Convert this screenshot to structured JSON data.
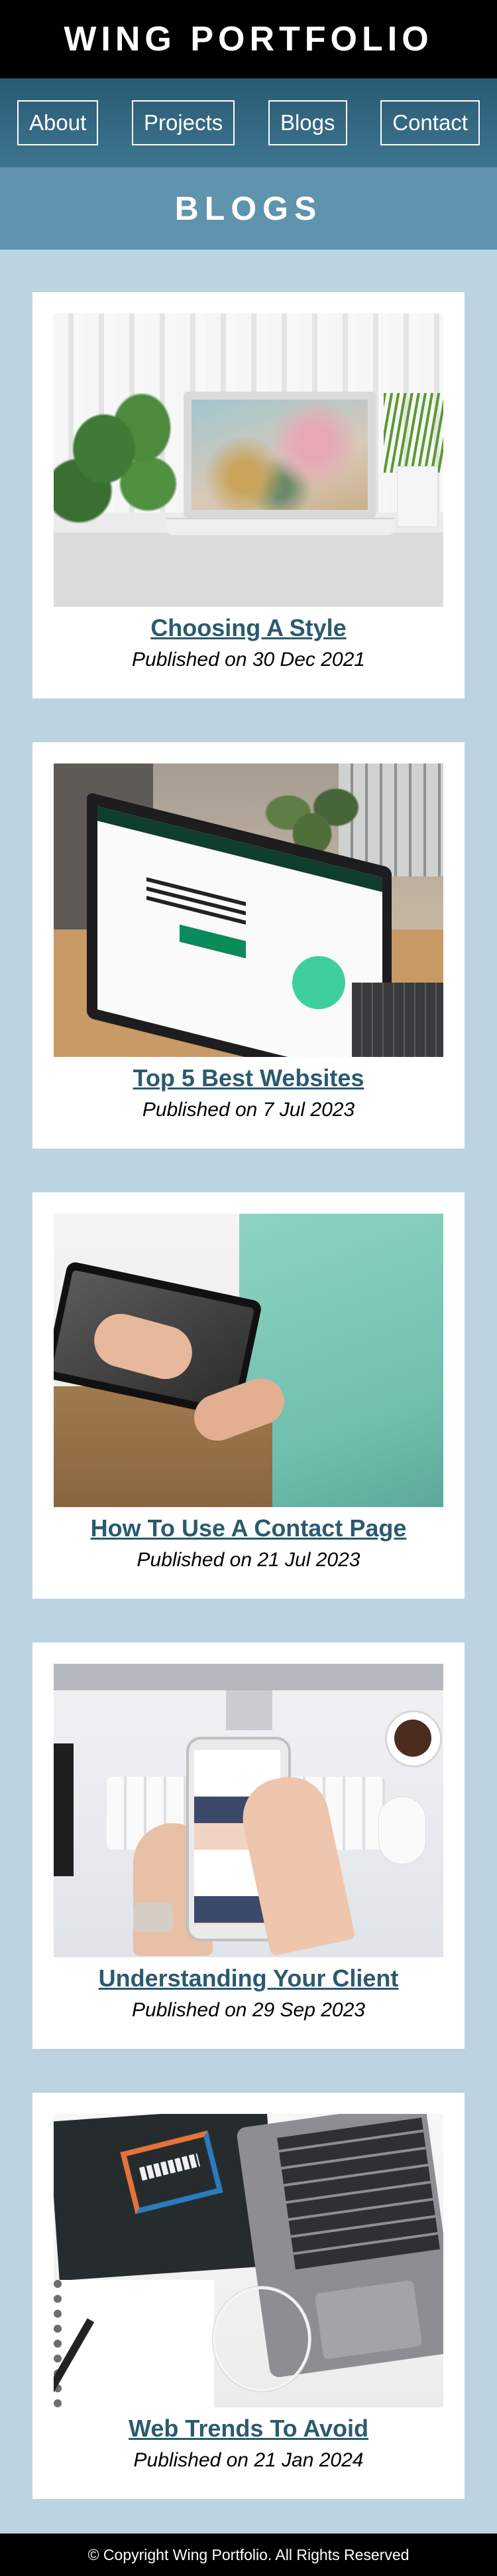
{
  "header": {
    "site_title": "WING PORTFOLIO"
  },
  "nav": {
    "items": [
      {
        "label": "About"
      },
      {
        "label": "Projects"
      },
      {
        "label": "Blogs"
      },
      {
        "label": "Contact"
      }
    ]
  },
  "section": {
    "title": "BLOGS"
  },
  "blogs": [
    {
      "title": "Choosing A Style",
      "date": "Published on 30 Dec 2021",
      "image_icon": "laptop-on-desk-image"
    },
    {
      "title": "Top 5 Best Websites",
      "date": "Published on 7 Jul 2023",
      "image_icon": "shopify-laptop-image"
    },
    {
      "title": "How To Use A Contact Page",
      "date": "Published on 21 Jul 2023",
      "image_icon": "tablet-in-hands-image"
    },
    {
      "title": "Understanding Your Client",
      "date": "Published on 29 Sep 2023",
      "image_icon": "phone-over-keyboard-image"
    },
    {
      "title": "Web Trends To Avoid",
      "date": "Published on 21 Jan 2024",
      "image_icon": "desk-with-books-image"
    }
  ],
  "footer": {
    "text": "© Copyright Wing Portfolio. All Rights Reserved"
  },
  "colors": {
    "header_bg": "#000000",
    "nav_bg": "#2a5a72",
    "banner_bg": "#5f93ae",
    "page_bg": "#bcd4e2",
    "card_bg": "#ffffff",
    "link_color": "#2b5a6f"
  }
}
